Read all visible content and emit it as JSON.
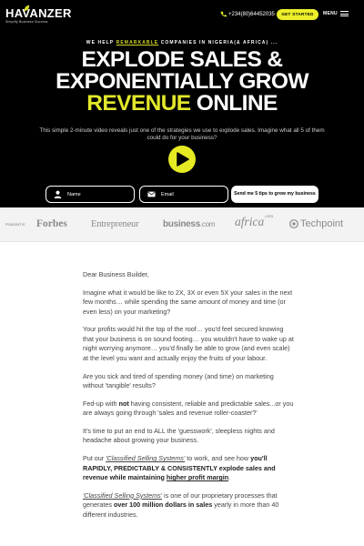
{
  "header": {
    "logo_text": "HAVANZER",
    "logo_tagline": "Simplify Business Success",
    "phone": "+234(80)64452035",
    "cta_label": "GET STARTED",
    "menu_label": "MENU"
  },
  "hero": {
    "tagline_pre": "WE HELP ",
    "tagline_highlight": "REMARKABLE",
    "tagline_post": " COMPANIES IN NIGERIA(& AFRICA) ...",
    "headline_line1": "EXPLODE SALES &",
    "headline_line2": "EXPONENTIALLY GROW",
    "headline_yellow": "REVENUE",
    "headline_line3_rest": " ONLINE",
    "subtext": "This simple 2-minute video reveals just one of the strategies we use to explode sales. Imagine what all 5 of them could do for your business?",
    "form": {
      "name_placeholder": "Name",
      "email_placeholder": "Email",
      "submit_label": "Send me 5 tips to grow my business"
    }
  },
  "press": {
    "label": "Featured in:",
    "logos": [
      "Forbes",
      "Entrepreneur",
      "business",
      ".com",
      "africa",
      ".com",
      "Techpoint"
    ]
  },
  "letter": {
    "greeting": "Dear Business Builder,",
    "p1": "Imagine what it would be like to 2X, 3X or even 5X your sales in the next few months… while spending the same amount of money and time (or even less) on your marketing?",
    "p2": "Your profits would hit the top of the roof… you'd feel secured knowing that your business is on sound footing… you wouldn't have to wake up at night worrying anymore… you'd finally be able to grow (and even scale) at the level you want and actually enjoy the fruits of your labour.",
    "p3": "Are you sick and tired of spending money (and time) on marketing without 'tangible' results?",
    "p4_pre": "Fed-up with ",
    "p4_bold": "not",
    "p4_post": " having consistent, reliable and predictable sales...or you are always going through 'sales and revenue roller-coaster?'",
    "p5": "It's time to put an end to ALL the 'guesswork', sleepless nights and headache about growing your business.",
    "p6_pre": "Put our ",
    "p6_em": "'Classified Selling Systems'",
    "p6_mid": " to work, and see how ",
    "p6_bold": "you'll RAPIDLY, PREDICTABLY & CONSISTENTLY explode sales and revenue while maintaining ",
    "p6_u": "higher profit margin",
    "p6_end": ".",
    "p7_em": "'Classified Selling Systems'",
    "p7_mid": " is one of our  proprietary processes that generates ",
    "p7_bold": "over 100 million dollars in sales",
    "p7_post": " yearly in more than 40 different industries."
  },
  "colors": {
    "accent_yellow": "#e2e82a",
    "hero_bg": "#000000"
  },
  "icons": [
    "phone-icon",
    "play-icon",
    "user-icon",
    "mail-icon",
    "menu-icon",
    "techpoint-logo-icon"
  ]
}
